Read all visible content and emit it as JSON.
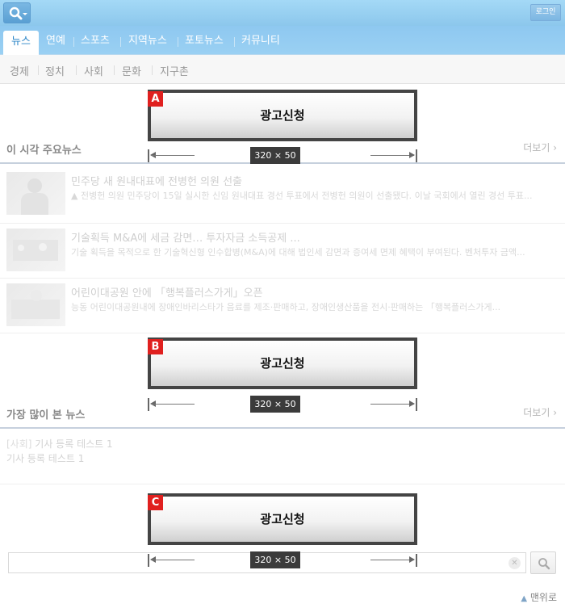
{
  "header": {
    "login_label": "로그인"
  },
  "main_nav": {
    "tabs": [
      "뉴스",
      "연예",
      "스포츠",
      "지역뉴스",
      "포토뉴스",
      "커뮤니티"
    ]
  },
  "sub_nav": {
    "items": [
      "경제",
      "정치",
      "사회",
      "문화",
      "지구촌"
    ]
  },
  "ads": [
    {
      "letter": "A",
      "label": "광고신청",
      "size": "320 × 50"
    },
    {
      "letter": "B",
      "label": "광고신청",
      "size": "320 × 50"
    },
    {
      "letter": "C",
      "label": "광고신청",
      "size": "320 × 50"
    }
  ],
  "top_news": {
    "title": "이 시각 주요뉴스",
    "more": "더보기",
    "items": [
      {
        "title": "민주당 새 원내대표에 전병헌 의원 선출",
        "desc": "▲ 전병헌 의원 민주당이 15일 실시한 신임 원내대표 경선 투표에서 전병헌 의원이 선출됐다. 이날 국회에서 열린 경선 투표..."
      },
      {
        "title": "기술획득 M&A에 세금 감면… 투자자금 소득공제 ...",
        "desc": "기술 획득을 목적으로 한 기술혁신형 인수합병(M&A)에 대해 법인세 감면과 증여세 면제 혜택이 부여된다. 벤처투자 금액..."
      },
      {
        "title": "어린이대공원 안에 「행복플러스가게」오픈",
        "desc": "능동 어린이대공원내에 장애인바리스타가 음료를 제조·판매하고, 장애인생산품을 전시·판매하는 「행복플러스가게..."
      }
    ]
  },
  "popular_news": {
    "title": "가장 많이 본 뉴스",
    "more": "더보기",
    "item": {
      "category": "[사회]",
      "title": "기사 등록 테스트 1",
      "desc": "기사 등록 테스트 1"
    }
  },
  "bottom": {
    "search_placeholder": "",
    "clear_label": "✕",
    "to_top_label": "맨위로"
  }
}
